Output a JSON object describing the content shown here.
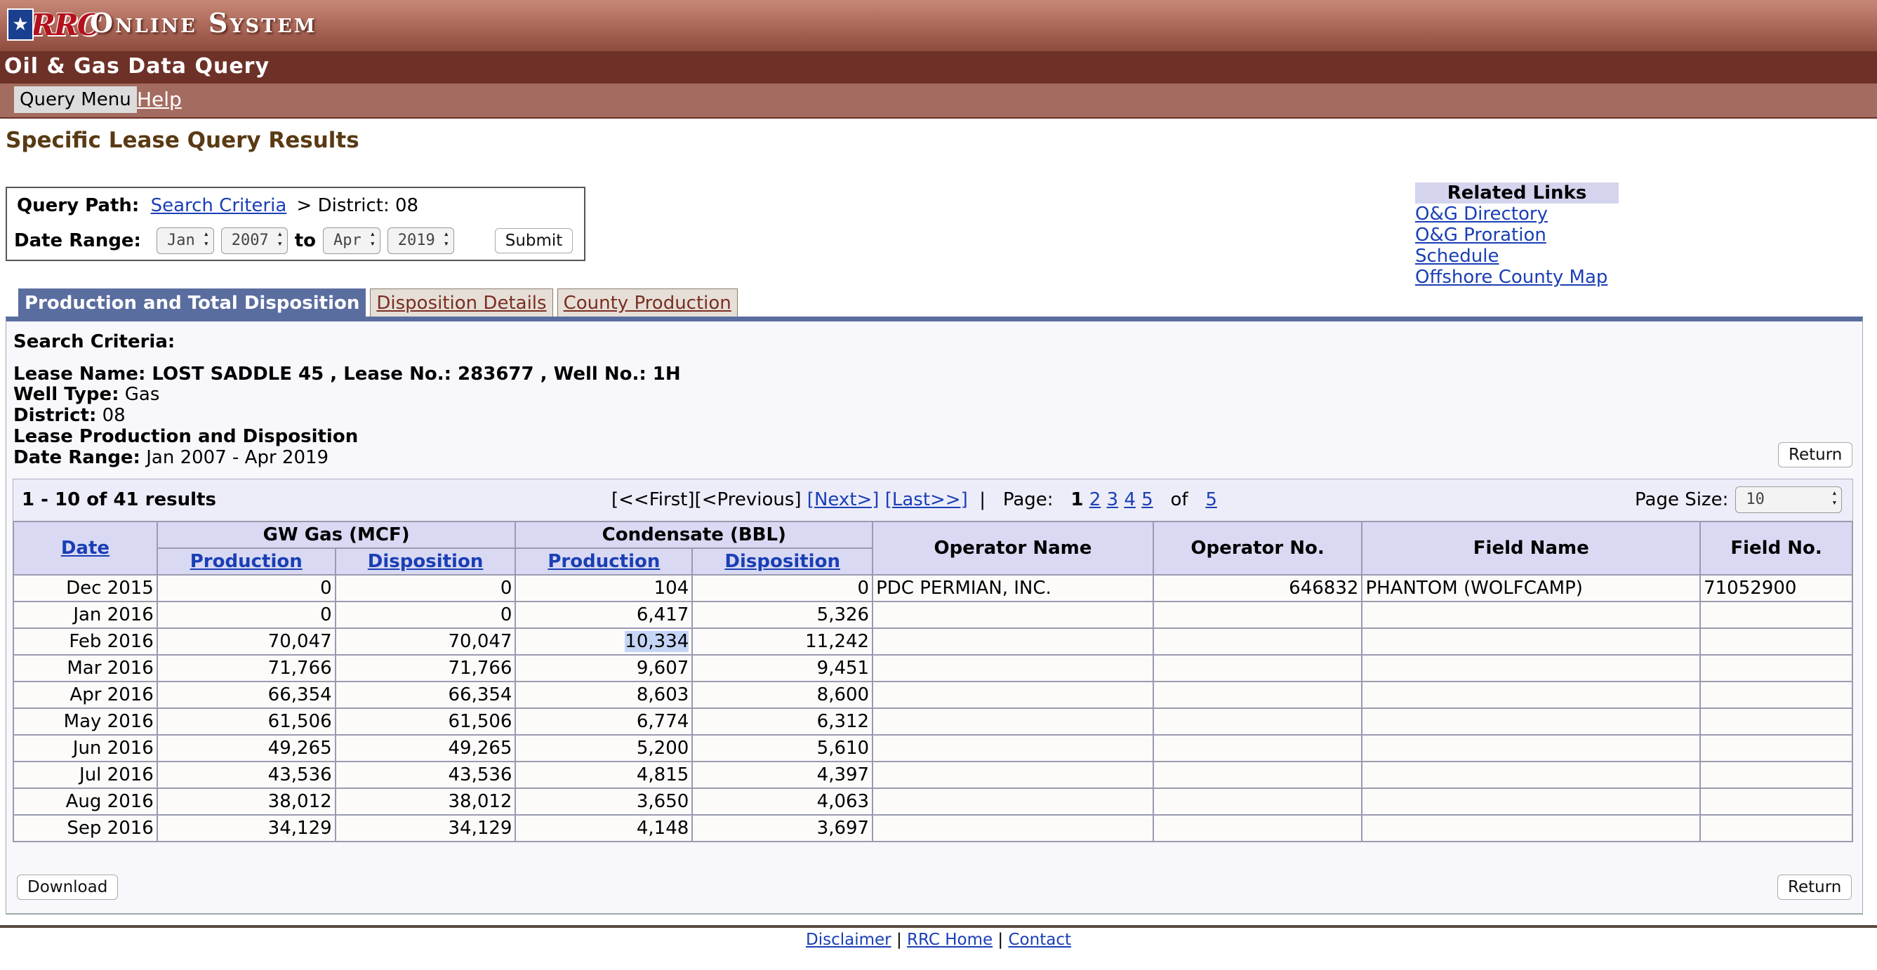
{
  "header": {
    "logo_text": "RRC",
    "system_name": "Online System",
    "subtitle": "Oil & Gas Data Query"
  },
  "menu": {
    "query_menu": "Query Menu",
    "help": "Help"
  },
  "page_title": "Specific Lease Query Results",
  "query": {
    "path_label": "Query Path:",
    "path_link": "Search Criteria",
    "path_rest": "> District: 08",
    "date_range_label": "Date Range:",
    "from_month": "Jan",
    "from_year": "2007",
    "to_label": "to",
    "to_month": "Apr",
    "to_year": "2019",
    "submit": "Submit"
  },
  "related": {
    "title": "Related Links",
    "links": [
      "O&G Directory",
      "O&G Proration Schedule",
      "Offshore County Map"
    ]
  },
  "tabs": [
    "Production and Total Disposition",
    "Disposition Details",
    "County Production"
  ],
  "criteria": {
    "heading": "Search Criteria:",
    "lease_line": "Lease Name: LOST SADDLE 45 , Lease No.: 283677 , Well No.: 1H",
    "well_type_label": "Well Type:",
    "well_type": "Gas",
    "district_label": "District:",
    "district": "08",
    "lpd": "Lease Production and Disposition",
    "date_range_label": "Date Range:",
    "date_range": "Jan 2007 - Apr 2019"
  },
  "buttons": {
    "return": "Return",
    "download": "Download"
  },
  "results": {
    "count": "1 - 10 of 41 results",
    "nav_prefix": "[<<First][<Previous] ",
    "next": "[Next>]",
    "last": "[Last>>]",
    "page_label": "  |   Page:  ",
    "current_page": "1",
    "pages": [
      "2",
      "3",
      "4",
      "5"
    ],
    "of_label": "of",
    "total_pages": "5",
    "page_size_label": "Page Size:",
    "page_size": "10"
  },
  "table": {
    "headers": {
      "date": "Date",
      "gw_gas": "GW Gas (MCF)",
      "condensate": "Condensate (BBL)",
      "production": "Production",
      "disposition": "Disposition",
      "operator_name": "Operator Name",
      "operator_no": "Operator No.",
      "field_name": "Field Name",
      "field_no": "Field No."
    },
    "rows": [
      [
        "Dec 2015",
        "0",
        "0",
        "104",
        "0",
        "PDC PERMIAN, INC.",
        "646832",
        "PHANTOM (WOLFCAMP)",
        "71052900"
      ],
      [
        "Jan 2016",
        "0",
        "0",
        "6,417",
        "5,326",
        "",
        "",
        "",
        ""
      ],
      [
        "Feb 2016",
        "70,047",
        "70,047",
        "10,334",
        "11,242",
        "",
        "",
        "",
        ""
      ],
      [
        "Mar 2016",
        "71,766",
        "71,766",
        "9,607",
        "9,451",
        "",
        "",
        "",
        ""
      ],
      [
        "Apr 2016",
        "66,354",
        "66,354",
        "8,603",
        "8,600",
        "",
        "",
        "",
        ""
      ],
      [
        "May 2016",
        "61,506",
        "61,506",
        "6,774",
        "6,312",
        "",
        "",
        "",
        ""
      ],
      [
        "Jun 2016",
        "49,265",
        "49,265",
        "5,200",
        "5,610",
        "",
        "",
        "",
        ""
      ],
      [
        "Jul 2016",
        "43,536",
        "43,536",
        "4,815",
        "4,397",
        "",
        "",
        "",
        ""
      ],
      [
        "Aug 2016",
        "38,012",
        "38,012",
        "3,650",
        "4,063",
        "",
        "",
        "",
        ""
      ],
      [
        "Sep 2016",
        "34,129",
        "34,129",
        "4,148",
        "3,697",
        "",
        "",
        "",
        ""
      ]
    ]
  },
  "footer": {
    "links": [
      "Disclaimer",
      "RRC Home",
      "Contact"
    ]
  }
}
